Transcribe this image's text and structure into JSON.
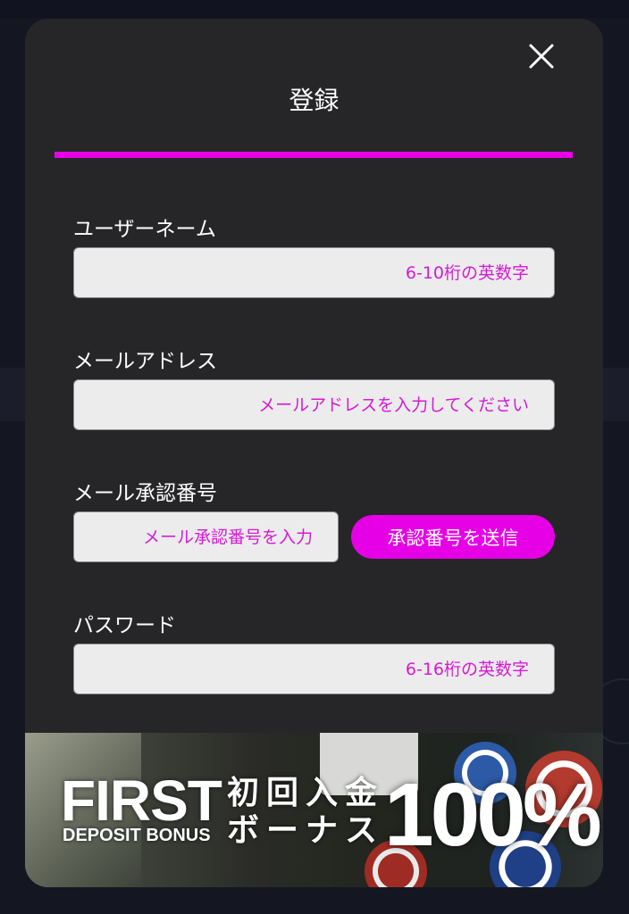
{
  "modal": {
    "title": "登録",
    "close_icon": "close-icon"
  },
  "form": {
    "username": {
      "label": "ユーザーネーム",
      "placeholder": "6-10桁の英数字",
      "value": ""
    },
    "email": {
      "label": "メールアドレス",
      "placeholder": "メールアドレスを入力してください",
      "value": ""
    },
    "verification": {
      "label": "メール承認番号",
      "placeholder": "メール承認番号を入力",
      "value": "",
      "send_button": "承認番号を送信"
    },
    "password": {
      "label": "パスワード",
      "placeholder": "6-16桁の英数字",
      "value": ""
    }
  },
  "banner": {
    "first": "FIRST",
    "deposit_bonus": "DEPOSIT BONUS",
    "jp_line1": "初回入金",
    "jp_line2": "ボーナス",
    "percent": "100%"
  },
  "colors": {
    "accent": "#e600e6",
    "modal_bg": "#262628",
    "placeholder": "#d61ad6",
    "input_bg": "#ececec"
  }
}
